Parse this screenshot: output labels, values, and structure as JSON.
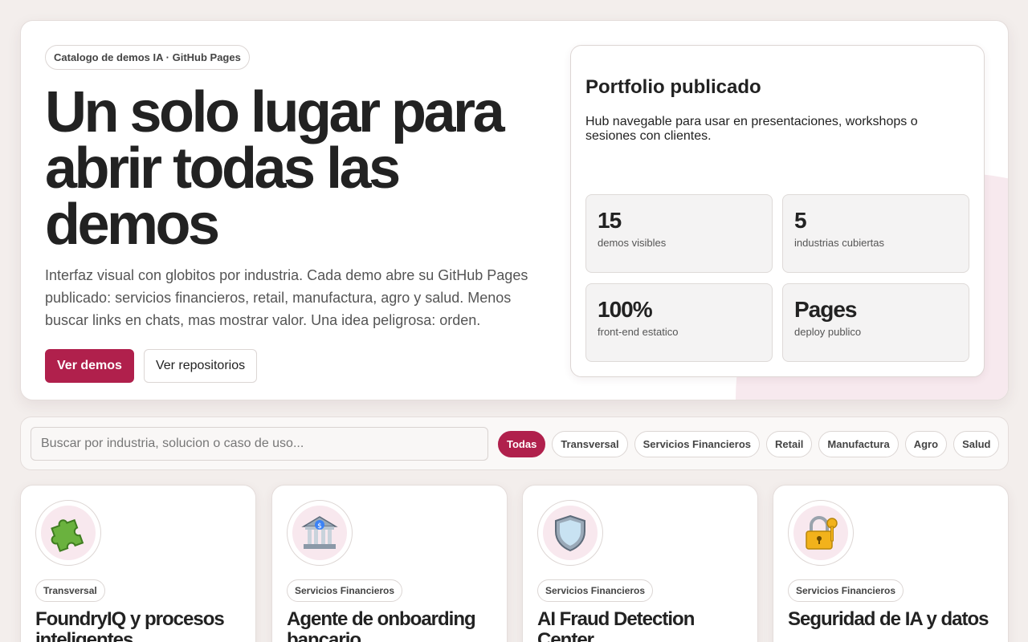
{
  "hero": {
    "chip": "Catalogo de demos IA · GitHub Pages",
    "title": "Un solo lugar para abrir todas las demos",
    "description": "Interfaz visual con globitos por industria. Cada demo abre su GitHub Pages publicado: servicios financieros, retail, manufactura, agro y salud. Menos buscar links en chats, mas mostrar valor. Una idea peligrosa: orden.",
    "primary_button": "Ver demos",
    "secondary_button": "Ver repositorios"
  },
  "portfolio": {
    "title": "Portfolio publicado",
    "description": "Hub navegable para usar en presentaciones, workshops o sesiones con clientes.",
    "stats": [
      {
        "value": "15",
        "label": "demos visibles"
      },
      {
        "value": "5",
        "label": "industrias cubiertas"
      },
      {
        "value": "100%",
        "label": "front-end estatico"
      },
      {
        "value": "Pages",
        "label": "deploy publico"
      }
    ]
  },
  "filters": {
    "search_placeholder": "Buscar por industria, solucion o caso de uso...",
    "pills": [
      "Todas",
      "Transversal",
      "Servicios Financieros",
      "Retail",
      "Manufactura",
      "Agro",
      "Salud"
    ],
    "active": "Todas"
  },
  "cards": [
    {
      "icon": "puzzle-icon",
      "tag": "Transversal",
      "title": "FoundryIQ y procesos inteligentes"
    },
    {
      "icon": "bank-icon",
      "tag": "Servicios Financieros",
      "title": "Agente de onboarding bancario"
    },
    {
      "icon": "shield-icon",
      "tag": "Servicios Financieros",
      "title": "AI Fraud Detection Center"
    },
    {
      "icon": "lock-key-icon",
      "tag": "Servicios Financieros",
      "title": "Seguridad de IA y datos"
    }
  ],
  "colors": {
    "accent": "#b0204c",
    "background": "#f3eeec",
    "icon_bg": "#f8e8ee"
  }
}
